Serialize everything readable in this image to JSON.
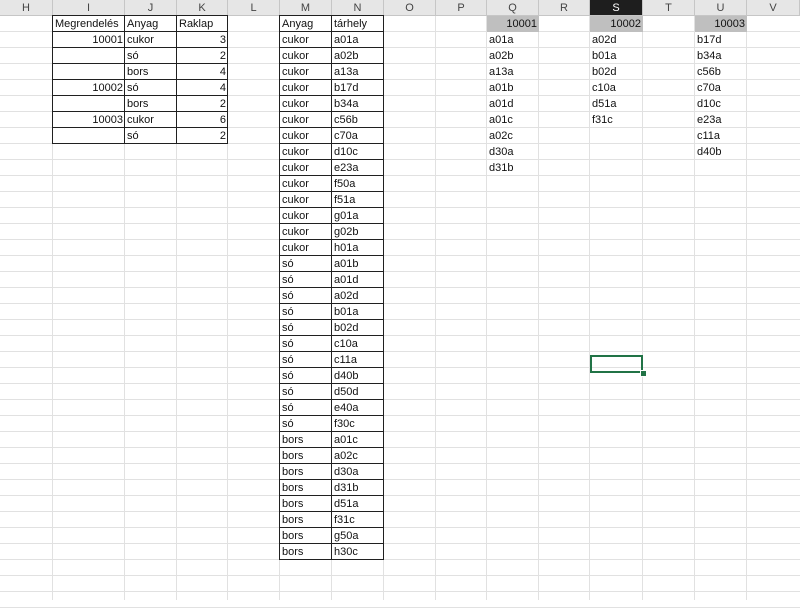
{
  "columns": [
    "H",
    "I",
    "J",
    "K",
    "L",
    "M",
    "N",
    "O",
    "P",
    "Q",
    "R",
    "S",
    "T",
    "U",
    "V"
  ],
  "selected_column": "S",
  "orders_table": {
    "headers": [
      "Megrendelés",
      "Anyag",
      "Raklap"
    ],
    "rows": [
      [
        "10001",
        "cukor",
        "3"
      ],
      [
        "",
        "só",
        "2"
      ],
      [
        "",
        "bors",
        "4"
      ],
      [
        "10002",
        "só",
        "4"
      ],
      [
        "",
        "bors",
        "2"
      ],
      [
        "10003",
        "cukor",
        "6"
      ],
      [
        "",
        "só",
        "2"
      ]
    ]
  },
  "storage_table": {
    "headers": [
      "Anyag",
      "tárhely"
    ],
    "rows": [
      [
        "cukor",
        "a01a"
      ],
      [
        "cukor",
        "a02b"
      ],
      [
        "cukor",
        "a13a"
      ],
      [
        "cukor",
        "b17d"
      ],
      [
        "cukor",
        "b34a"
      ],
      [
        "cukor",
        "c56b"
      ],
      [
        "cukor",
        "c70a"
      ],
      [
        "cukor",
        "d10c"
      ],
      [
        "cukor",
        "e23a"
      ],
      [
        "cukor",
        "f50a"
      ],
      [
        "cukor",
        "f51a"
      ],
      [
        "cukor",
        "g01a"
      ],
      [
        "cukor",
        "g02b"
      ],
      [
        "cukor",
        "h01a"
      ],
      [
        "só",
        "a01b"
      ],
      [
        "só",
        "a01d"
      ],
      [
        "só",
        "a02d"
      ],
      [
        "só",
        "b01a"
      ],
      [
        "só",
        "b02d"
      ],
      [
        "só",
        "c10a"
      ],
      [
        "só",
        "c11a"
      ],
      [
        "só",
        "d40b"
      ],
      [
        "só",
        "d50d"
      ],
      [
        "só",
        "e40a"
      ],
      [
        "só",
        "f30c"
      ],
      [
        "bors",
        "a01c"
      ],
      [
        "bors",
        "a02c"
      ],
      [
        "bors",
        "d30a"
      ],
      [
        "bors",
        "d31b"
      ],
      [
        "bors",
        "d51a"
      ],
      [
        "bors",
        "f31c"
      ],
      [
        "bors",
        "g50a"
      ],
      [
        "bors",
        "h30c"
      ]
    ]
  },
  "result_columns": [
    {
      "header": "10001",
      "values": [
        "a01a",
        "a02b",
        "a13a",
        "a01b",
        "a01d",
        "a01c",
        "a02c",
        "d30a",
        "d31b"
      ]
    },
    {
      "header": "10002",
      "values": [
        "a02d",
        "b01a",
        "b02d",
        "c10a",
        "d51a",
        "f31c"
      ]
    },
    {
      "header": "10003",
      "values": [
        "b17d",
        "b34a",
        "c56b",
        "c70a",
        "d10c",
        "e23a",
        "c11a",
        "d40b"
      ]
    }
  ]
}
